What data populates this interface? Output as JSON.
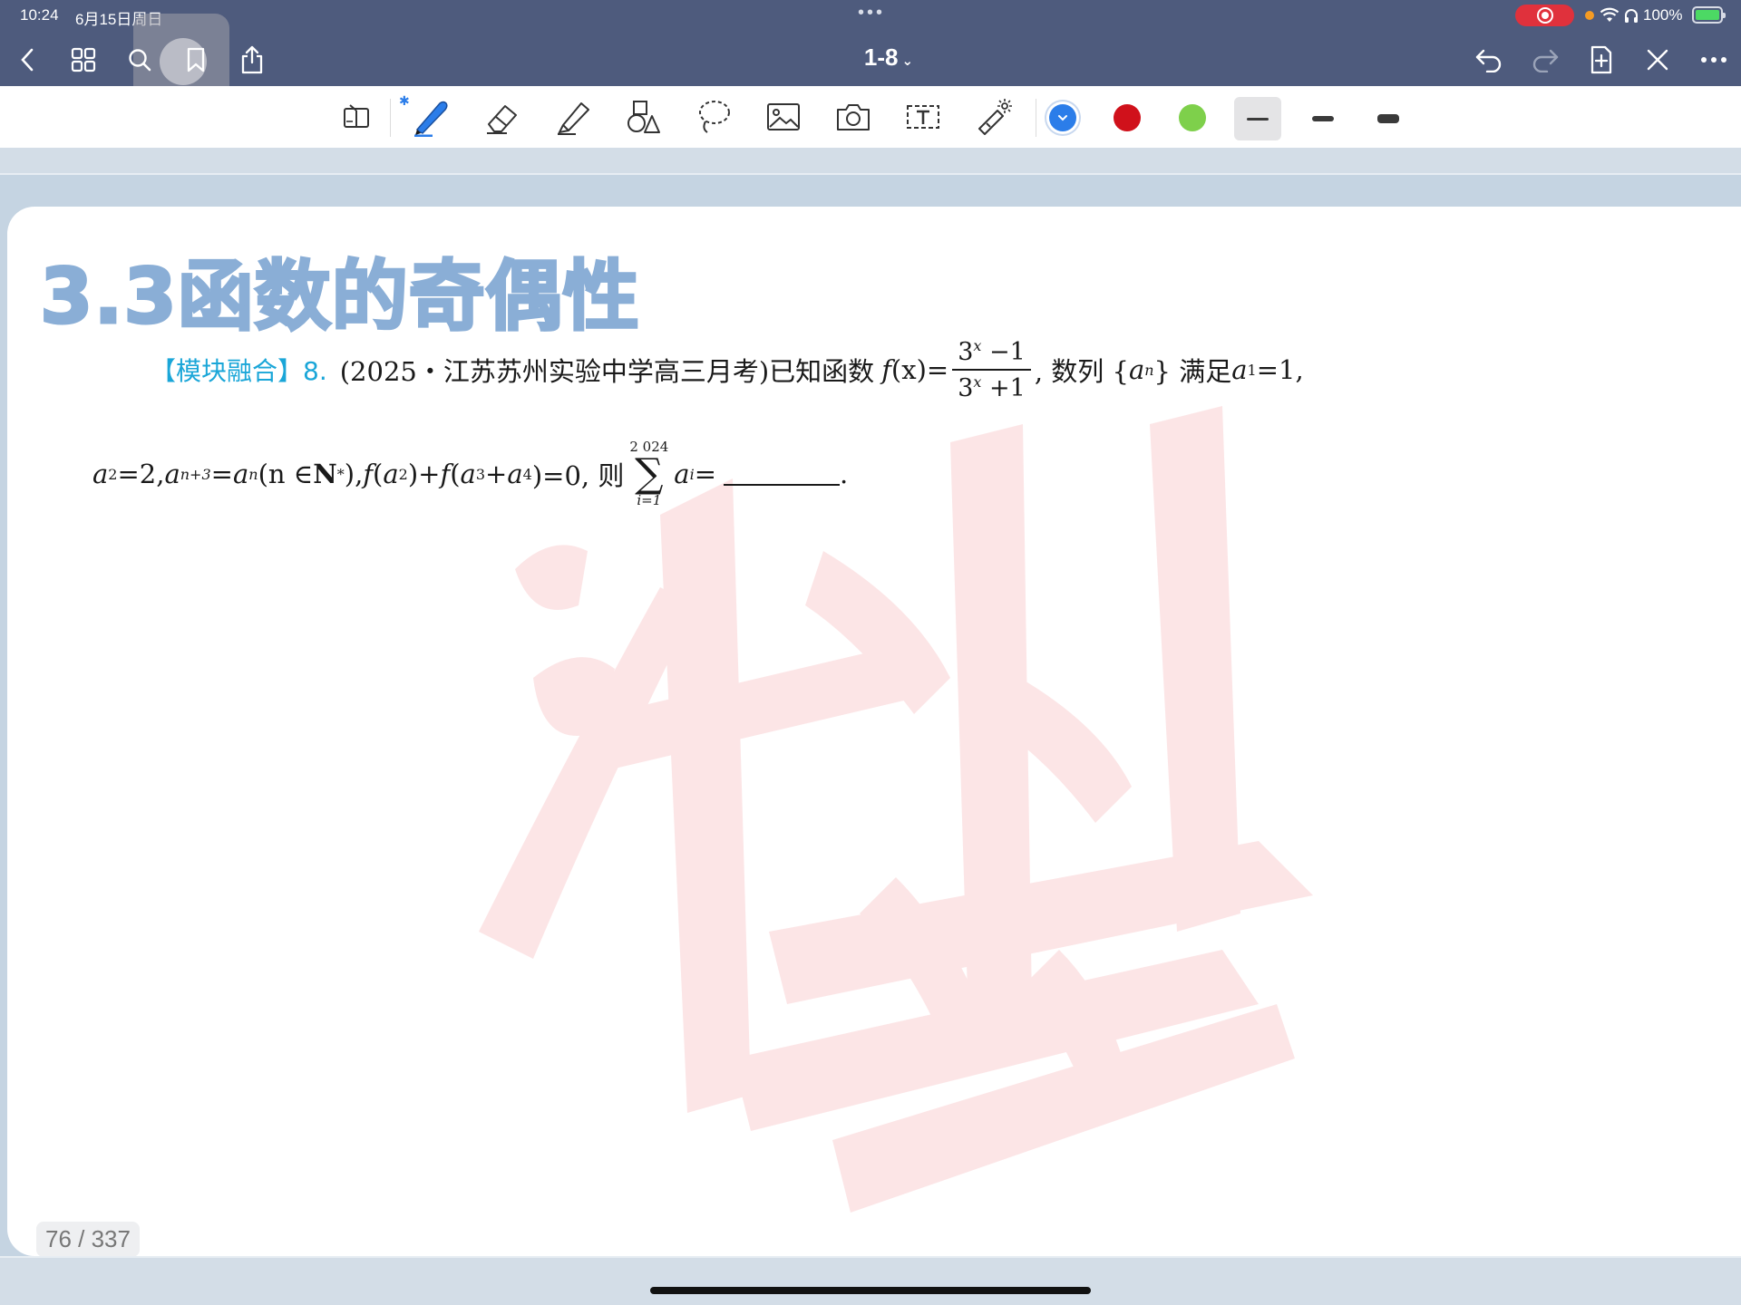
{
  "status_bar": {
    "time": "10:24",
    "date": "6月15日周日",
    "battery": "100%"
  },
  "nav": {
    "doc_title": "1-8",
    "title_chevron": "⌄"
  },
  "toolbar": {
    "colors": {
      "blue": "#2b7de9",
      "red": "#d0111b",
      "green": "#7ed04b",
      "accent_bar": "#4e5b7d"
    }
  },
  "page": {
    "section_title": "3.3函数的奇偶性",
    "question": {
      "tag": "【模块融合】",
      "number": "8.",
      "source": "(2025・江苏苏州实验中学高三月考)",
      "text_known": "已知函数",
      "fx": "f",
      "fx_arg": "(x)=",
      "frac_num_base": "3",
      "frac_num_exp": "x",
      "frac_num_rest": " −1",
      "frac_den_base": "3",
      "frac_den_exp": "x",
      "frac_den_rest": " +1",
      "text_seq": ", 数列 {",
      "seq_a": "a",
      "seq_sub": "n",
      "text_satisfy": "} 满足 ",
      "a1": "a",
      "a1_sub": "1",
      "a1_val": " =1,",
      "a2": "a",
      "a2_sub": "2",
      "a2_val": " =2, ",
      "an3": "a",
      "an3_sub": "n+3",
      "eq_an": " =",
      "an": "a",
      "an_sub": "n",
      "n_in": "(n ∈ ",
      "N": "N",
      "N_sup": "*",
      "n_close": "), ",
      "f1": "f",
      "f1_arg_open": "(",
      "fa2": "a",
      "fa2_sub": "2",
      "f1_close": ")+",
      "f2": "f",
      "f2_open": "(",
      "fa3": "a",
      "fa3_sub": "3",
      "plus": " +",
      "fa4": "a",
      "fa4_sub": "4",
      "f2_close": ")=0, 则",
      "sum_upper": "2 024",
      "sum_sigma": "∑",
      "sum_lower": "i=1",
      "ai": "a",
      "ai_sub": "i",
      "ai_eq": " =",
      "end": "."
    },
    "page_counter": "76 / 337"
  }
}
